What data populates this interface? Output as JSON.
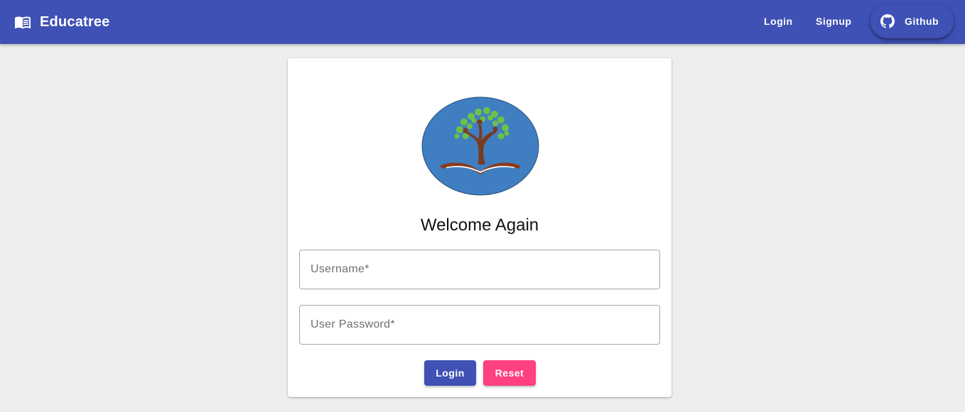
{
  "appbar": {
    "brand_icon": "menu-book-icon",
    "title": "Educatree",
    "nav": {
      "login_label": "Login",
      "signup_label": "Signup",
      "github_label": "Github",
      "github_icon": "github-icon"
    },
    "color": "#3f51b5"
  },
  "card": {
    "logo": "educatree-tree-book-logo",
    "welcome": "Welcome Again",
    "username": {
      "value": "",
      "placeholder": "Username*"
    },
    "password": {
      "value": "",
      "placeholder": "User Password*"
    },
    "buttons": {
      "login_label": "Login",
      "reset_label": "Reset"
    }
  },
  "colors": {
    "primary": "#3f51b5",
    "accent": "#ff4081",
    "background": "#eeeeee"
  }
}
